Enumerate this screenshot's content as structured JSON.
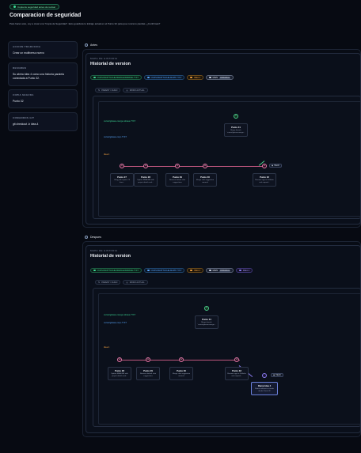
{
  "badge": "Copia de seguridad antes de revisar",
  "page_title": "Comparacion de seguridad",
  "description": "Para hacer esto, voy a crear una \"Copia de Seguridad\". Esto guardara tu trabajo actual en el Punto 32 para que nunca lo pierdas. ¿Confirmas?",
  "sidebar": [
    {
      "header": "ACCION TRADUCIDA",
      "value": "Crear un multiverso nuevo"
    },
    {
      "header": "RESUMEN",
      "value": "Su abrira Idea 4 como una historia paralela conectada a Punto 32."
    },
    {
      "header": "COPIA SEGURA",
      "value": "Punto 32"
    },
    {
      "header": "COMANDOS GIT",
      "value": "git checkout -b idea-4"
    }
  ],
  "before": {
    "label": "Antes",
    "map_header": "MAPA DE HISTORIA",
    "history_title": "Historial de version",
    "chips": [
      {
        "label": "CURSOR/ATTACHE-MERGE-REBASE-7YF7",
        "color": "#3ddc97"
      },
      {
        "label": "CURSOR/ATTACHE-MAPP-7YF7",
        "color": "#5aa8ff"
      },
      {
        "label": "IDEA 4",
        "color": "#f0a040"
      },
      {
        "label": "MAIN",
        "color": "#cfd6e4"
      }
    ],
    "main_tag": "ORIGINAL",
    "controls": {
      "parent": "PARENT / CHILD",
      "active": "MODO ACTUAL"
    },
    "branches": {
      "merge": "cursor/gitsave-merge-rebase-7YF7",
      "mapp": "cursor/gitsave-mvp-7YF7",
      "idea": "Idea 4"
    },
    "top_node": {
      "num": "31",
      "title": "Punto 31",
      "sub": "Merge branch 'cursor/gitsave-merge..."
    },
    "nodes": [
      {
        "num": "27",
        "title": "Punto 27",
        "sub": "Okay pull request #3 from..."
      },
      {
        "num": "28",
        "title": "Punto 28",
        "sub": "Update README with project details and..."
      },
      {
        "num": "29",
        "title": "Punto 29",
        "sub": "Remove default shot suggestions"
      },
      {
        "num": "30",
        "title": "Punto 30",
        "sub": "Merge shot suggestion removal"
      },
      {
        "num": "32",
        "title": "Punto 32",
        "sub": "Rename app to GitSafer and expand..."
      }
    ],
    "head_tag": "HEAD"
  },
  "after": {
    "label": "Despues",
    "map_header": "MAPA DE HISTORIA",
    "history_title": "Historial de version",
    "chips": [
      {
        "label": "CURSOR/ATTACHE-MERGE-REBASE-7YF7",
        "color": "#3ddc97"
      },
      {
        "label": "CURSOR/ATTACHE-MAPP-7YF7",
        "color": "#5aa8ff"
      },
      {
        "label": "IDEA 4",
        "color": "#f0a040"
      },
      {
        "label": "MAIN",
        "color": "#cfd6e4"
      },
      {
        "label": "IDEA 4",
        "color": "#8a7cf0"
      }
    ],
    "main_tag": "ORIGINAL",
    "controls": {
      "parent": "PARENT / CHILD",
      "active": "MODO ACTUAL"
    },
    "branches": {
      "merge": "cursor/gitsave-merge-rebase-7YF7",
      "mapp": "cursor/gitsave-mvp-7YF7",
      "idea": "Idea 4"
    },
    "top_node": {
      "num": "31",
      "title": "Punto 31",
      "sub": "Merge branch 'cursor/gitsave-merge..."
    },
    "nodes": [
      {
        "num": "28",
        "title": "Punto 28",
        "sub": "Update README with project details and..."
      },
      {
        "num": "29",
        "title": "Punto 29",
        "sub": "Remove default shot suggestions"
      },
      {
        "num": "30",
        "title": "Punto 30",
        "sub": "Merge shot suggestion removal"
      },
      {
        "num": "32",
        "title": "Punto 32",
        "sub": "Rename app to GitSafer and expand..."
      }
    ],
    "head_tag": "HEAD",
    "new_card": {
      "title": "Rama Idea 4",
      "sub": "Rama multiverso creada desde Punto 32"
    }
  }
}
